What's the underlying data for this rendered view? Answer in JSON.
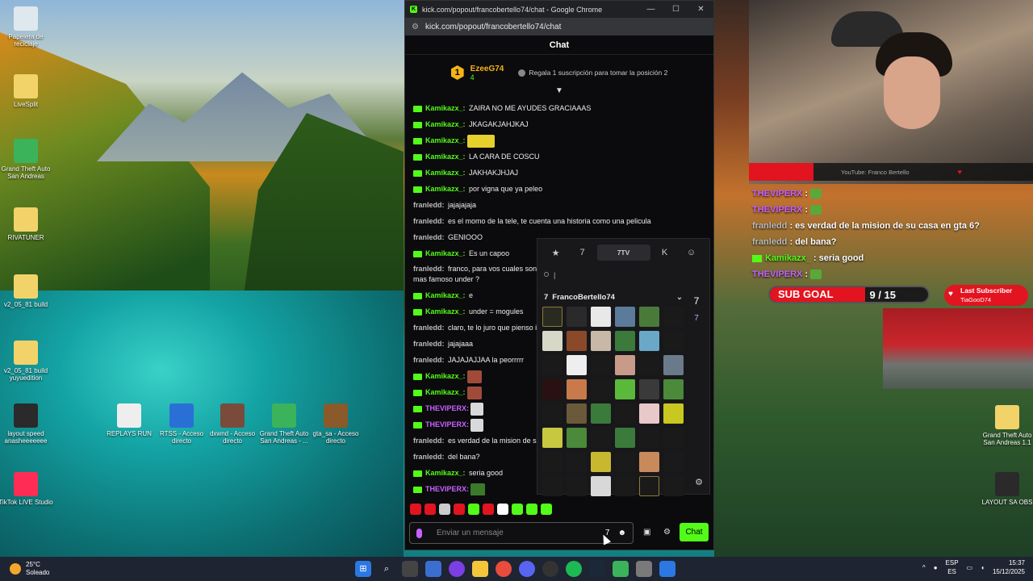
{
  "desktop": {
    "icons": [
      {
        "label": "Papelera de reciclaje",
        "color": "#dfe8ef"
      },
      {
        "label": "LiveSplit",
        "color": "#f1d36a"
      },
      {
        "label": "Grand Theft Auto San Andreas",
        "color": "#3bb35a"
      },
      {
        "label": "RIVATUNER",
        "color": "#f1d36a"
      },
      {
        "label": "v2_05_81 build",
        "color": "#f1d36a"
      },
      {
        "label": "v2_05_81 build yuyuedition",
        "color": "#f1d36a"
      },
      {
        "label": "layout speed anasheeeeeee",
        "color": "#2a2a2a"
      },
      {
        "label": "REPLAYS RUN",
        "color": "#eeeeee"
      },
      {
        "label": "RTSS - Acceso directo",
        "color": "#2a6fd6"
      },
      {
        "label": "dxwnd - Acceso directo",
        "color": "#7a4b3a"
      },
      {
        "label": "Grand Theft Auto San Andreas - ...",
        "color": "#3bb35a"
      },
      {
        "label": "gta_sa - Acceso directo",
        "color": "#8a5a2a"
      },
      {
        "label": "TikTok LIVE Studio",
        "color": "#ff2d55"
      },
      {
        "label": "Grand Theft Auto San Andreas 1.1",
        "color": "#f1d36a"
      },
      {
        "label": "LAYOUT SA OBS",
        "color": "#2a2a2a"
      }
    ]
  },
  "browser": {
    "title": "kick.com/popout/francobertello74/chat - Google Chrome",
    "url": "kick.com/popout/francobertello74/chat",
    "controls": {
      "min": "—",
      "max": "☐",
      "close": "✕"
    }
  },
  "chat": {
    "header": "Chat",
    "pinned": {
      "rank": "1",
      "user": "EzeeG74",
      "count": "4",
      "cta": "Regala 1 suscripción para tomar la posición 2"
    },
    "messages": [
      {
        "user": "Kamikazx_:",
        "text": "ZAIRA NO ME AYUDES GRACIAAAS",
        "color": "g",
        "badge": true
      },
      {
        "user": "Kamikazx_:",
        "text": "JKAGAKJAHJKAJ",
        "color": "g",
        "badge": true
      },
      {
        "user": "Kamikazx_:",
        "text": "",
        "color": "g",
        "badge": true,
        "emote": "y"
      },
      {
        "user": "Kamikazx_:",
        "text": "LA CARA DE COSCU",
        "color": "g",
        "badge": true
      },
      {
        "user": "Kamikazx_:",
        "text": "JAKHAKJHJAJ",
        "color": "g",
        "badge": true
      },
      {
        "user": "Kamikazx_:",
        "text": "por vigna que ya peleo",
        "color": "g",
        "badge": true
      },
      {
        "user": "franledd:",
        "text": "jajajajaja",
        "color": "gr",
        "badge": false
      },
      {
        "user": "franledd:",
        "text": "es el momo de la tele, te cuenta una historia como una pelicula",
        "color": "gr",
        "badge": false
      },
      {
        "user": "franledd:",
        "text": "GENIOOO",
        "color": "gr",
        "badge": false
      },
      {
        "user": "Kamikazx_:",
        "text": "Es un capoo",
        "color": "g",
        "badge": true
      },
      {
        "user": "franledd:",
        "text": "franco, para vos cuales son los mas famoso under ?",
        "color": "gr",
        "badge": false,
        "two": true
      },
      {
        "user": "Kamikazx_:",
        "text": "e",
        "color": "g",
        "badge": true
      },
      {
        "user": "Kamikazx_:",
        "text": "under = mogules",
        "color": "g",
        "badge": true
      },
      {
        "user": "franledd:",
        "text": "claro, te lo juro que pienso i",
        "color": "gr",
        "badge": false
      },
      {
        "user": "franledd:",
        "text": "jajajaaa",
        "color": "gr",
        "badge": false
      },
      {
        "user": "franledd:",
        "text": "JAJAJAJJAA la peorrrrr",
        "color": "gr",
        "badge": false
      },
      {
        "user": "Kamikazx_:",
        "text": "",
        "color": "g",
        "badge": true,
        "emote": "r"
      },
      {
        "user": "Kamikazx_:",
        "text": "",
        "color": "g",
        "badge": true,
        "emote": "r"
      },
      {
        "user": "THEVIPERX:",
        "text": "",
        "color": "pu",
        "badge": true,
        "emote": "w"
      },
      {
        "user": "THEVIPERX:",
        "text": "",
        "color": "pu",
        "badge": true,
        "emote": "w"
      },
      {
        "user": "franledd:",
        "text": "es verdad de la mision de su",
        "color": "gr",
        "badge": false
      },
      {
        "user": "franledd:",
        "text": "del bana?",
        "color": "gr",
        "badge": false
      },
      {
        "user": "Kamikazx_:",
        "text": "seria good",
        "color": "g",
        "badge": true
      },
      {
        "user": "THEVIPERX:",
        "text": "",
        "color": "pu",
        "badge": true,
        "emote": "f"
      }
    ],
    "input_placeholder": "Enviar un mensaje",
    "send_label": "Chat"
  },
  "picker": {
    "tabs": {
      "active": "7TV"
    },
    "search": "|",
    "set_name": "FrancoBertello74",
    "emotes": [
      "#2a2a20",
      "#2a2a2a",
      "#e8e8e8",
      "#5c7a9a",
      "#4a7a3a",
      "#1a1a1a",
      "#d8d8c8",
      "#8a4a2a",
      "#c8b8a8",
      "#3c7a3c",
      "#6aa8c8",
      "#1a1a1a",
      "#1a1a1a",
      "#eeeeee",
      "#1a1a1a",
      "#c89a8a",
      "#1a1a1a",
      "#6a7a8a",
      "#2a1010",
      "#c87a4a",
      "#1a1a1a",
      "#5ab83a",
      "#3a3a3a",
      "#4a8a3a",
      "#1a1a1a",
      "#6a5a3a",
      "#3a7a3a",
      "#1a1a1a",
      "#e8c8c8",
      "#c8c820",
      "#c8c840",
      "#4a8a3a",
      "#1a1a1a",
      "#3a7a3a",
      "#1a1a1a",
      "#1a1a1a",
      "#1a1a1a",
      "#1a1a1a",
      "#c8b830",
      "#1a1a1a",
      "#c88a5a",
      "#1a1a1a",
      "#1a1a1a",
      "#1a1a1a",
      "#d8d8d8",
      "#1a1a1a",
      "#1a1a1a",
      "#1a1a1a"
    ]
  },
  "quick_emotes": [
    "#e1141f",
    "#e1141f",
    "#cccccc",
    "#e1141f",
    "#53fc18",
    "#e1141f",
    "#ffffff",
    "#53fc18",
    "#53fc18",
    "#53fc18"
  ],
  "stream": {
    "cam_caption": "YouTube: Franco Bertello",
    "overlay_chat": [
      {
        "user": "THEVIPERX",
        "text": ":",
        "color": "pu",
        "badge": false,
        "emote": true
      },
      {
        "user": "THEVIPERX",
        "text": ":",
        "color": "pu",
        "badge": false,
        "emote": true
      },
      {
        "user": "franledd",
        "text": ": es verdad de la mision de su casa en gta 6?",
        "color": "gr",
        "badge": false,
        "emote": false
      },
      {
        "user": "franledd",
        "text": ": del bana?",
        "color": "gr",
        "badge": false,
        "emote": false
      },
      {
        "user": "Kamikazx_",
        "text": ": seria good",
        "color": "g",
        "badge": true,
        "emote": false
      },
      {
        "user": "THEVIPERX",
        "text": ":",
        "color": "pu",
        "badge": false,
        "emote": true
      }
    ],
    "sub_goal": {
      "label": "SUB GOAL",
      "count": "9 / 15",
      "progress": 0.6
    },
    "last_sub": {
      "title": "Last Subscriber",
      "name": "TiaGooD74"
    }
  },
  "taskbar": {
    "weather": {
      "temp": "25°C",
      "desc": "Soleado"
    },
    "lang": {
      "l1": "ESP",
      "l2": "ES"
    },
    "time": "15:37",
    "date": "15/12/2025"
  }
}
